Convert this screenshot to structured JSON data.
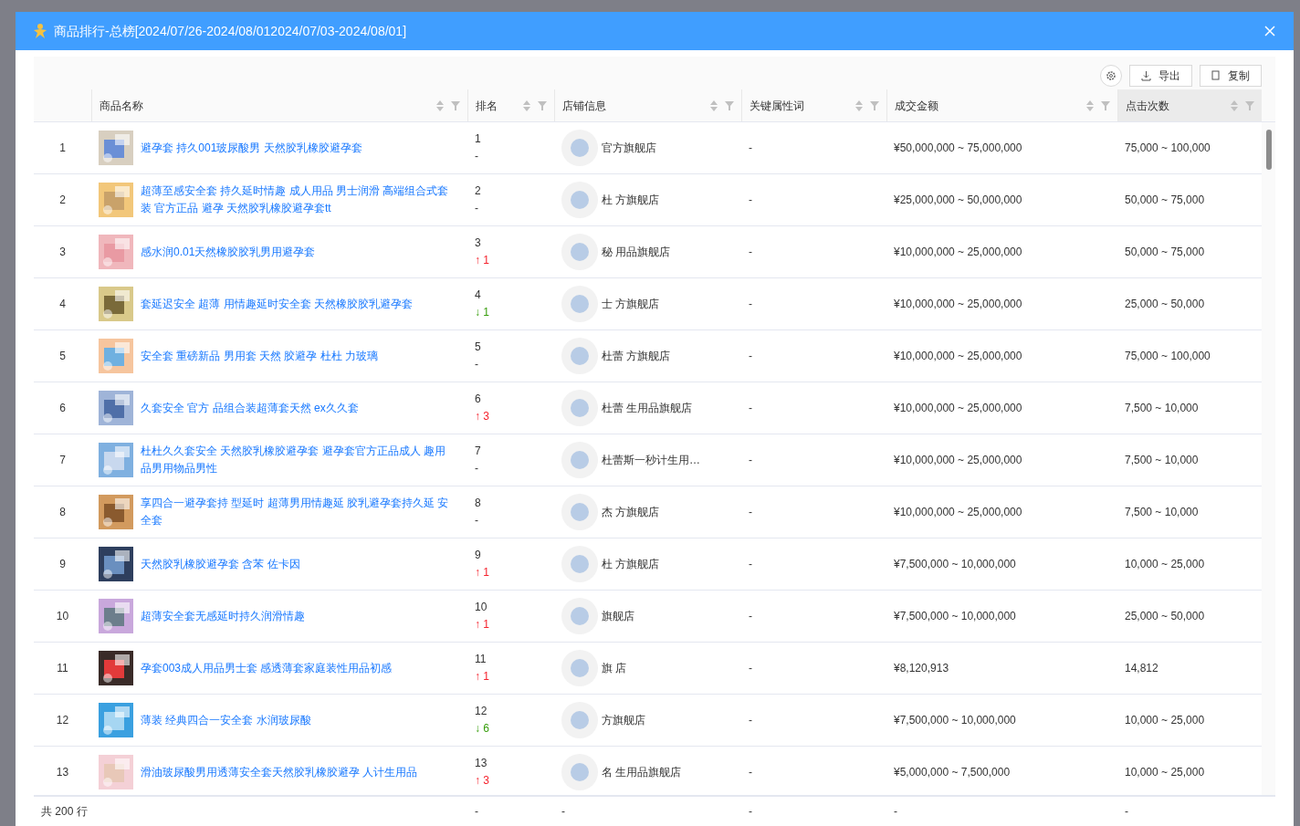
{
  "dialog": {
    "title": "商品排行-总榜[2024/07/26-2024/08/012024/07/03-2024/08/01]"
  },
  "toolbar": {
    "export": "导出",
    "copy": "复制"
  },
  "table": {
    "columns": [
      {
        "label": "商品名称",
        "sorted": false
      },
      {
        "label": "排名",
        "sorted": false
      },
      {
        "label": "店铺信息",
        "sorted": false
      },
      {
        "label": "关键属性词",
        "sorted": false
      },
      {
        "label": "成交金额",
        "sorted": false
      },
      {
        "label": "点击次数",
        "sorted": true
      }
    ],
    "rows": [
      {
        "index": "1",
        "name": "避孕套 持久001玻尿酸男 天然胶乳橡胶避孕套",
        "rank": "1",
        "change": "-",
        "kind": "none",
        "store": "官方旗舰店",
        "keyword": "-",
        "amount": "¥50,000,000 ~ 75,000,000",
        "clicks": "75,000 ~ 100,000"
      },
      {
        "index": "2",
        "name": "超薄至感安全套 持久延时情趣 成人用品 男士润滑 高端组合式套装 官方正品 避孕 天然胶乳橡胶避孕套tt",
        "rank": "2",
        "change": "-",
        "kind": "none",
        "store": "杜 方旗舰店",
        "keyword": "-",
        "amount": "¥25,000,000 ~ 50,000,000",
        "clicks": "50,000 ~ 75,000"
      },
      {
        "index": "3",
        "name": "感水润0.01天然橡胶胶乳男用避孕套",
        "rank": "3",
        "change": "↑ 1",
        "kind": "up",
        "store": "秘 用品旗舰店",
        "keyword": "-",
        "amount": "¥10,000,000 ~ 25,000,000",
        "clicks": "50,000 ~ 75,000"
      },
      {
        "index": "4",
        "name": "套延迟安全 超薄 用情趣延时安全套 天然橡胶胶乳避孕套",
        "rank": "4",
        "change": "↓ 1",
        "kind": "down",
        "store": "士 方旗舰店",
        "keyword": "-",
        "amount": "¥10,000,000 ~ 25,000,000",
        "clicks": "25,000 ~ 50,000"
      },
      {
        "index": "5",
        "name": "安全套 重磅新品 男用套 天然 胶避孕 杜杜 力玻璃",
        "rank": "5",
        "change": "-",
        "kind": "none",
        "store": "杜蕾 方旗舰店",
        "keyword": "-",
        "amount": "¥10,000,000 ~ 25,000,000",
        "clicks": "75,000 ~ 100,000"
      },
      {
        "index": "6",
        "name": "久套安全 官方 品组合装超薄套天然 ex久久套",
        "rank": "6",
        "change": "↑ 3",
        "kind": "up",
        "store": "杜蕾 生用品旗舰店",
        "keyword": "-",
        "amount": "¥10,000,000 ~ 25,000,000",
        "clicks": "7,500 ~ 10,000"
      },
      {
        "index": "7",
        "name": "杜杜久久套安全 天然胶乳橡胶避孕套 避孕套官方正品成人 趣用品男用物品男性",
        "rank": "7",
        "change": "-",
        "kind": "none",
        "store": "杜蕾斯一秒计生用…",
        "keyword": "-",
        "amount": "¥10,000,000 ~ 25,000,000",
        "clicks": "7,500 ~ 10,000"
      },
      {
        "index": "8",
        "name": "享四合一避孕套持 型延时 超薄男用情趣延 胶乳避孕套持久延 安全套",
        "rank": "8",
        "change": "-",
        "kind": "none",
        "store": "杰 方旗舰店",
        "keyword": "-",
        "amount": "¥10,000,000 ~ 25,000,000",
        "clicks": "7,500 ~ 10,000"
      },
      {
        "index": "9",
        "name": "天然胶乳橡胶避孕套 含苯 佐卡因",
        "rank": "9",
        "change": "↑ 1",
        "kind": "up",
        "store": "杜 方旗舰店",
        "keyword": "-",
        "amount": "¥7,500,000 ~ 10,000,000",
        "clicks": "10,000 ~ 25,000"
      },
      {
        "index": "10",
        "name": "超薄安全套无感延时持久润滑情趣",
        "rank": "10",
        "change": "↑ 1",
        "kind": "up",
        "store": "旗舰店",
        "keyword": "-",
        "amount": "¥7,500,000 ~ 10,000,000",
        "clicks": "25,000 ~ 50,000"
      },
      {
        "index": "11",
        "name": "孕套003成人用品男士套 感透薄套家庭装性用品初感",
        "rank": "11",
        "change": "↑ 1",
        "kind": "up",
        "store": "旗 店",
        "keyword": "-",
        "amount": "¥8,120,913",
        "clicks": "14,812"
      },
      {
        "index": "12",
        "name": "薄装 经典四合一安全套 水润玻尿酸",
        "rank": "12",
        "change": "↓ 6",
        "kind": "down",
        "store": "方旗舰店",
        "keyword": "-",
        "amount": "¥7,500,000 ~ 10,000,000",
        "clicks": "10,000 ~ 25,000"
      },
      {
        "index": "13",
        "name": "滑油玻尿酸男用透薄安全套天然胶乳橡胶避孕 人计生用品",
        "rank": "13",
        "change": "↑ 3",
        "kind": "up",
        "store": "名 生用品旗舰店",
        "keyword": "-",
        "amount": "¥5,000,000 ~ 7,500,000",
        "clicks": "10,000 ~ 25,000"
      }
    ],
    "footer": {
      "label": "共 200 行",
      "cells": [
        "-",
        "-",
        "-",
        "-",
        "-"
      ]
    }
  }
}
